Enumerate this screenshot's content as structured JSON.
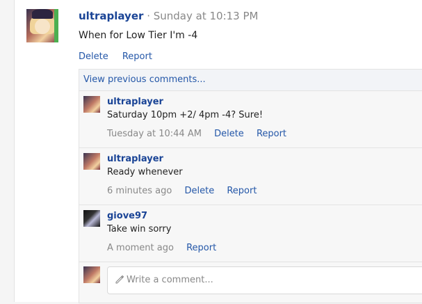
{
  "post": {
    "username": "ultraplayer",
    "separator": "·",
    "timestamp": "Sunday at 10:13 PM",
    "text": "When for Low Tier I'm -4",
    "actions": {
      "delete": "Delete",
      "report": "Report"
    }
  },
  "comments_section": {
    "view_previous": "View previous comments...",
    "comments": [
      {
        "username": "ultraplayer",
        "text": "Saturday 10pm +2/ 4pm -4? Sure!",
        "time": "Tuesday at 10:44 AM",
        "delete": "Delete",
        "report": "Report"
      },
      {
        "username": "ultraplayer",
        "text": "Ready whenever",
        "time": "6 minutes ago",
        "delete": "Delete",
        "report": "Report"
      },
      {
        "username": "giove97",
        "text": "Take win sorry",
        "time": "A moment ago",
        "report": "Report"
      }
    ],
    "write_placeholder": "Write a comment..."
  },
  "icons": {
    "pencil": "pencil-icon"
  },
  "colors": {
    "link": "#2457a8",
    "username": "#1a4496",
    "muted": "#888888"
  }
}
